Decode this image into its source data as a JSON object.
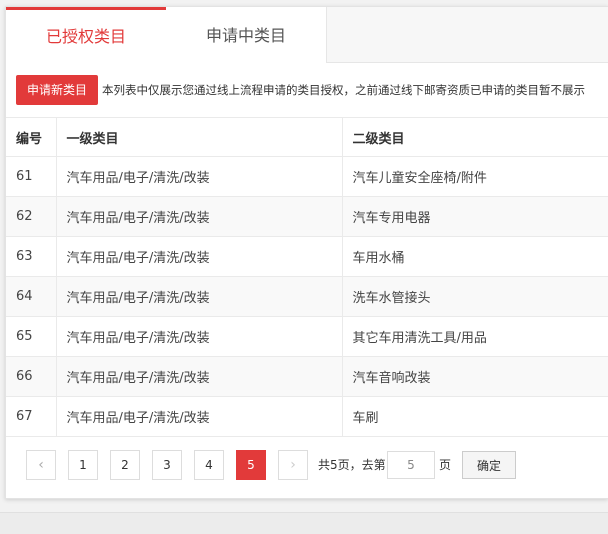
{
  "tabs": [
    {
      "label": "已授权类目",
      "active": true
    },
    {
      "label": "申请中类目",
      "active": false
    }
  ],
  "apply": {
    "button_label": "申请新类目",
    "notice": "本列表中仅展示您通过线上流程申请的类目授权，之前通过线下邮寄资质已申请的类目暂不展示"
  },
  "table": {
    "headers": [
      "编号",
      "一级类目",
      "二级类目"
    ],
    "rows": [
      {
        "id": "61",
        "level1": "汽车用品/电子/清洗/改装",
        "level2": "汽车儿童安全座椅/附件"
      },
      {
        "id": "62",
        "level1": "汽车用品/电子/清洗/改装",
        "level2": "汽车专用电器"
      },
      {
        "id": "63",
        "level1": "汽车用品/电子/清洗/改装",
        "level2": "车用水桶"
      },
      {
        "id": "64",
        "level1": "汽车用品/电子/清洗/改装",
        "level2": "洗车水管接头"
      },
      {
        "id": "65",
        "level1": "汽车用品/电子/清洗/改装",
        "level2": "其它车用清洗工具/用品"
      },
      {
        "id": "66",
        "level1": "汽车用品/电子/清洗/改装",
        "level2": "汽车音响改装"
      },
      {
        "id": "67",
        "level1": "汽车用品/电子/清洗/改装",
        "level2": "车刷"
      }
    ]
  },
  "pagination": {
    "prev": "‹",
    "next": "›",
    "pages": [
      "1",
      "2",
      "3",
      "4",
      "5"
    ],
    "current": "5",
    "total_text": "共5页，去第",
    "page_input_value": "5",
    "page_suffix": "页",
    "confirm_label": "确定"
  },
  "colors": {
    "accent": "#e23a3a"
  }
}
